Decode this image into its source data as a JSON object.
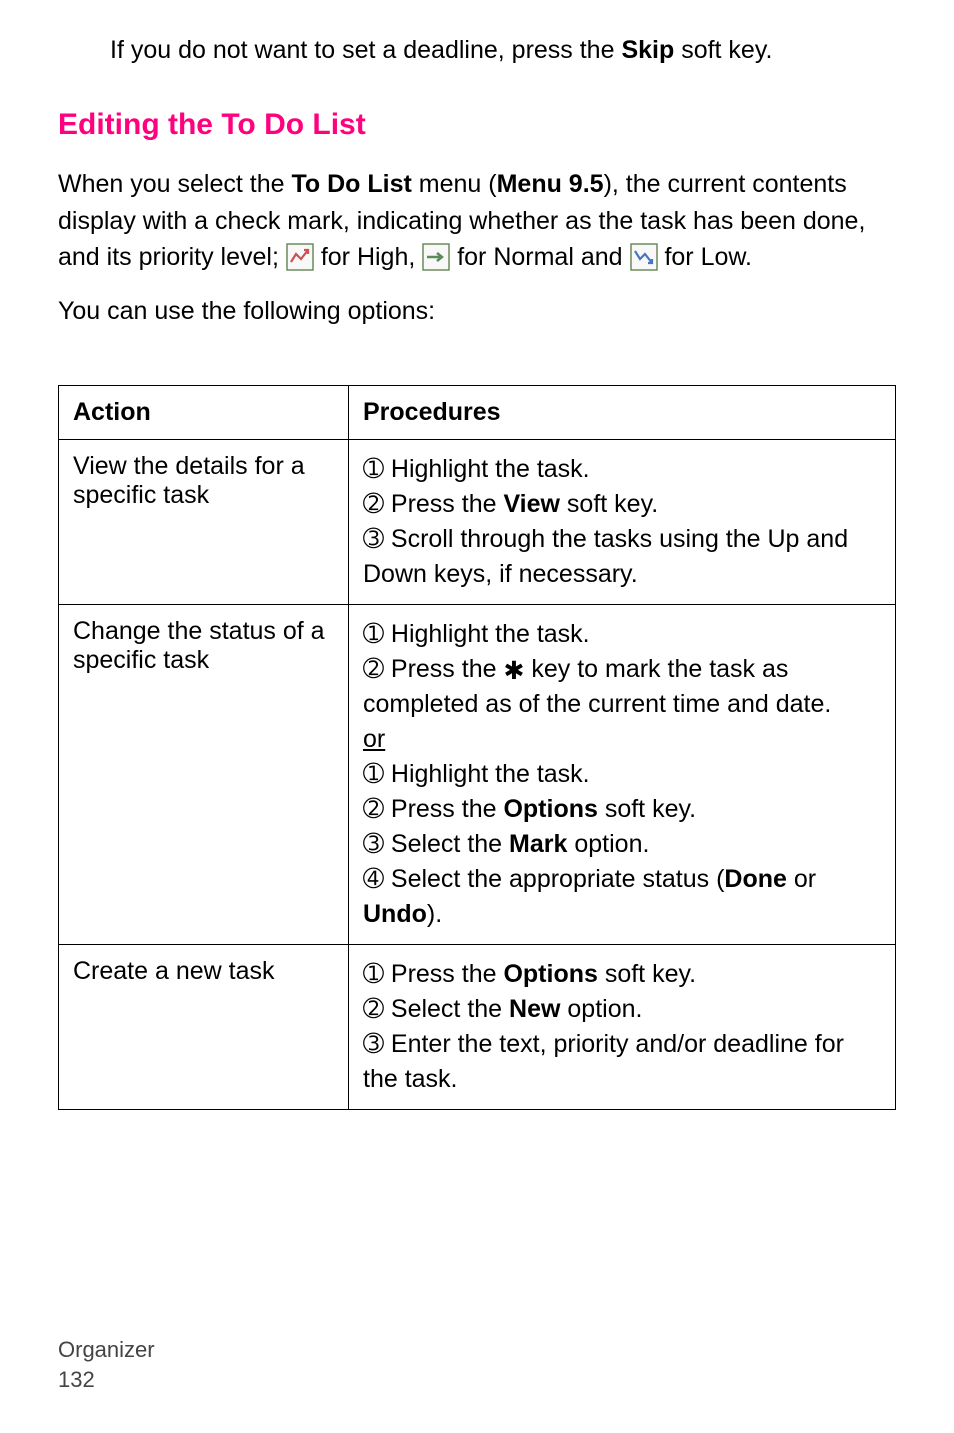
{
  "intro1_a": "If you do not want to set a deadline, press the ",
  "intro1_b": "Skip",
  "intro1_c": " soft key.",
  "heading": "Editing the To Do List",
  "intro2_a": "When you select the ",
  "intro2_b": "To Do List",
  "intro2_c": " menu (",
  "intro2_d": "Menu 9.5",
  "intro2_e": "), the current contents display with a check mark, indicating whether as the task has been done, and its priority level; ",
  "intro2_f": " for High, ",
  "intro2_g": " for Normal and ",
  "intro2_h": " for Low.",
  "intro3": "You can use the following options:",
  "table": {
    "headers": {
      "action": "Action",
      "proc": "Procedures"
    },
    "row1": {
      "action": "View the details for a specific task",
      "p1a": "➀ Highlight the task.",
      "p2a": "➁ Press the ",
      "p2b": "View",
      "p2c": " soft key.",
      "p3a": "➂ Scroll through the tasks using the Up and Down keys, if necessary."
    },
    "row2": {
      "action": "Change the status of a specific task",
      "p1": "➀ Highlight the task.",
      "p2a": "➁ Press the ",
      "p2b": " key to mark the task as completed as of the current time and date.",
      "or": "or",
      "p1b": "➀ Highlight the task.",
      "p2ba": "➁ Press the ",
      "p2bb": "Options",
      "p2bc": " soft key.",
      "p3a": "➂ Select the ",
      "p3b": "Mark",
      "p3c": " option.",
      "p4a": "➃ Select the appropriate status (",
      "p4b": "Done",
      "p4c": " or ",
      "p4d": "Undo",
      "p4e": ")."
    },
    "row3": {
      "action": "Create a new task",
      "p1a": "➀ Press the ",
      "p1b": "Options",
      "p1c": " soft key.",
      "p2a": "➁ Select the ",
      "p2b": "New",
      "p2c": " option.",
      "p3": "➂ Enter the text, priority and/or deadline for the task."
    }
  },
  "footer": {
    "section": "Organizer",
    "page": "132"
  }
}
